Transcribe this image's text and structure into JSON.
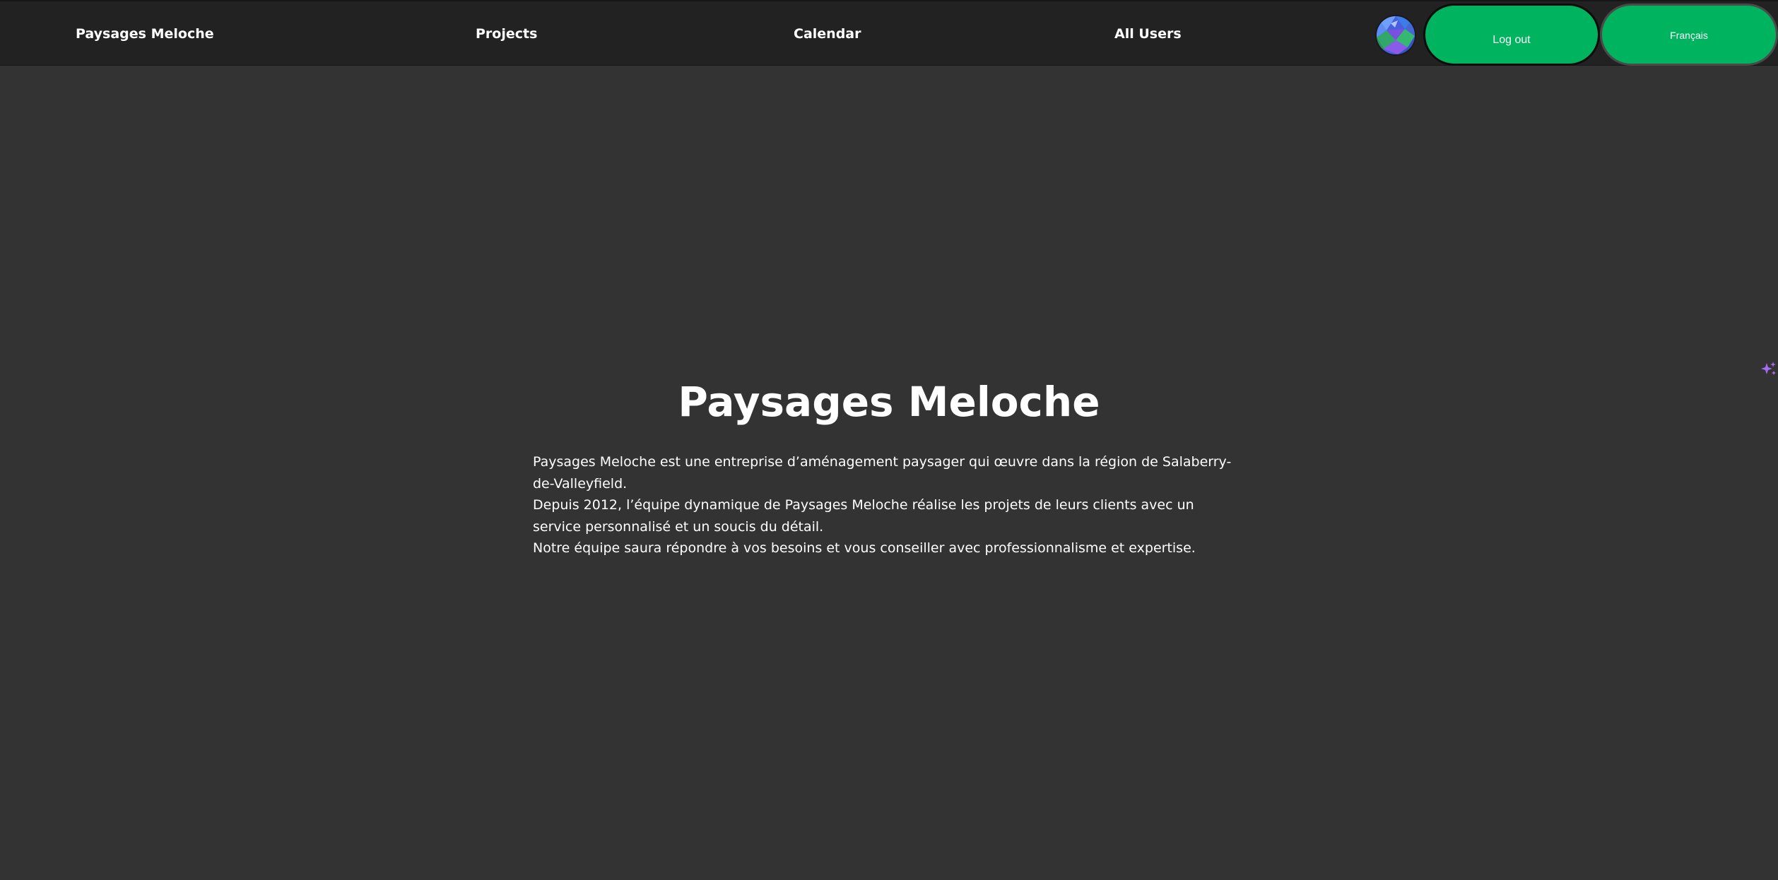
{
  "nav": {
    "brand": "Paysages Meloche",
    "links": [
      "Projects",
      "Calendar",
      "All Users"
    ],
    "logout_label": "Log out",
    "language_label": "Français"
  },
  "main": {
    "title": "Paysages Meloche",
    "paragraphs": [
      "Paysages Meloche est une entreprise d’aménagement paysager qui œuvre dans la région de Salaberry-de-Valleyfield.",
      "Depuis 2012, l’équipe dynamique de Paysages Meloche réalise les projets de leurs clients avec un service personnalisé et un soucis du détail.",
      "Notre équipe saura répondre à vos besoins et vous conseiller avec professionnalisme et expertise."
    ]
  },
  "colors": {
    "background": "#333333",
    "navbar": "#222222",
    "button_green": "#00b35f",
    "text": "#ffffff",
    "sparkle_purple": "#a66cf0"
  },
  "icons": {
    "avatar": "user-avatar",
    "assistant": "sparkle-icon"
  }
}
